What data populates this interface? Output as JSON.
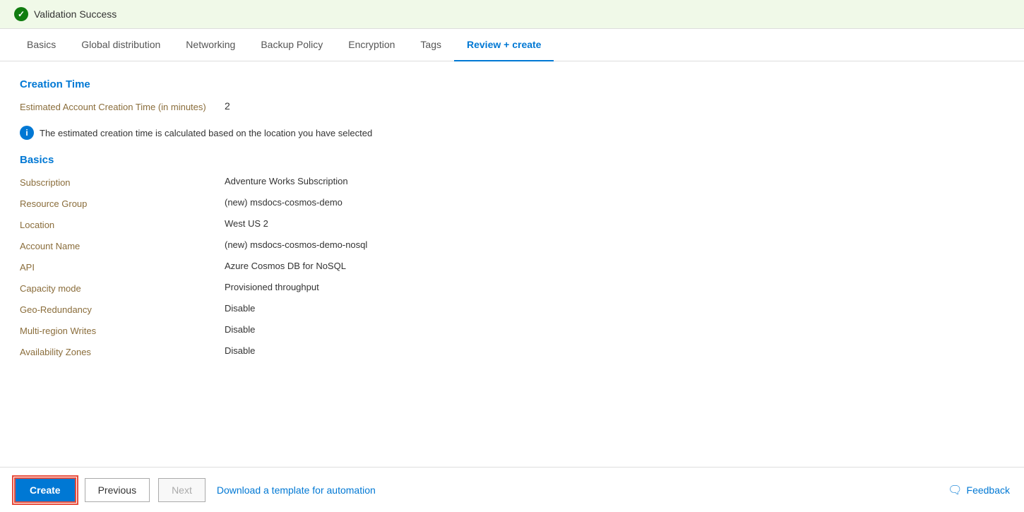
{
  "validation": {
    "icon": "check-circle-icon",
    "text": "Validation Success"
  },
  "tabs": [
    {
      "id": "basics",
      "label": "Basics",
      "active": false
    },
    {
      "id": "global-distribution",
      "label": "Global distribution",
      "active": false
    },
    {
      "id": "networking",
      "label": "Networking",
      "active": false
    },
    {
      "id": "backup-policy",
      "label": "Backup Policy",
      "active": false
    },
    {
      "id": "encryption",
      "label": "Encryption",
      "active": false
    },
    {
      "id": "tags",
      "label": "Tags",
      "active": false
    },
    {
      "id": "review-create",
      "label": "Review + create",
      "active": true
    }
  ],
  "creation_time_section": {
    "heading": "Creation Time",
    "rows": [
      {
        "label": "Estimated Account Creation Time (in minutes)",
        "value": "2"
      }
    ],
    "info_text": "The estimated creation time is calculated based on the location you have selected"
  },
  "basics_section": {
    "heading": "Basics",
    "rows": [
      {
        "label": "Subscription",
        "value": "Adventure Works Subscription"
      },
      {
        "label": "Resource Group",
        "value": "(new) msdocs-cosmos-demo"
      },
      {
        "label": "Location",
        "value": "West US 2"
      },
      {
        "label": "Account Name",
        "value": "(new) msdocs-cosmos-demo-nosql"
      },
      {
        "label": "API",
        "value": "Azure Cosmos DB for NoSQL"
      },
      {
        "label": "Capacity mode",
        "value": "Provisioned throughput"
      },
      {
        "label": "Geo-Redundancy",
        "value": "Disable"
      },
      {
        "label": "Multi-region Writes",
        "value": "Disable"
      },
      {
        "label": "Availability Zones",
        "value": "Disable"
      }
    ]
  },
  "footer": {
    "create_label": "Create",
    "previous_label": "Previous",
    "next_label": "Next",
    "download_label": "Download a template for automation",
    "feedback_label": "Feedback"
  }
}
